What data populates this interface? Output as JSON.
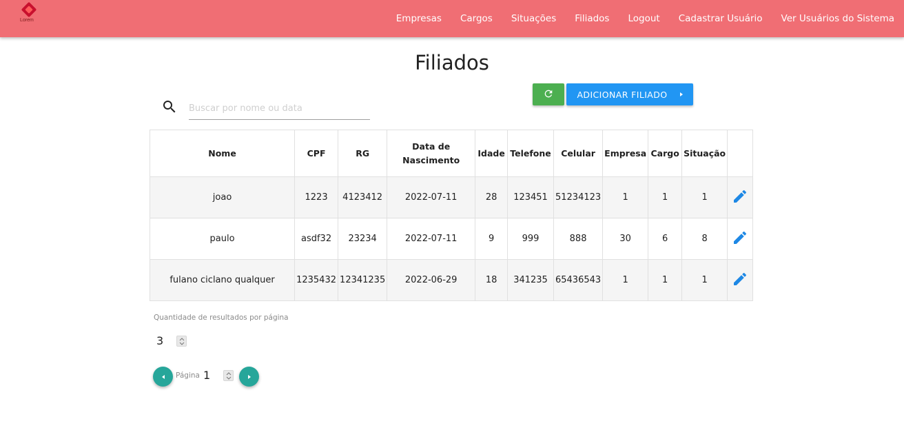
{
  "brand": {
    "logo_text": "Lorem"
  },
  "nav": {
    "items": [
      "Empresas",
      "Cargos",
      "Situações",
      "Filiados",
      "Logout",
      "Cadastrar Usuário",
      "Ver Usuários do Sistema"
    ]
  },
  "page": {
    "title": "Filiados"
  },
  "search": {
    "placeholder": "Buscar por nome ou data",
    "value": ""
  },
  "toolbar": {
    "add_label": "ADICIONAR FILIADO",
    "refresh_icon": "refresh-icon"
  },
  "table": {
    "headers": [
      "Nome",
      "CPF",
      "RG",
      "Data de Nascimento",
      "Idade",
      "Telefone",
      "Celular",
      "Empresa",
      "Cargo",
      "Situação",
      ""
    ],
    "rows": [
      [
        "joao",
        "1223",
        "4123412",
        "2022-07-11",
        "28",
        "123451",
        "51234123",
        "1",
        "1",
        "1"
      ],
      [
        "paulo",
        "asdf32",
        "23234",
        "2022-07-11",
        "9",
        "999",
        "888",
        "30",
        "6",
        "8"
      ],
      [
        "fulano ciclano qualquer",
        "1235432",
        "12341235",
        "2022-06-29",
        "18",
        "341235",
        "65436543",
        "1",
        "1",
        "1"
      ]
    ]
  },
  "pagination": {
    "per_page_label": "Quantidade de resultados por página",
    "per_page_value": "3",
    "page_label": "Página",
    "page_value": "1"
  },
  "colors": {
    "navbar": "#f06e74",
    "refresh_button": "#4caf50",
    "add_button": "#2196f3",
    "edit_icon": "#1e88e5",
    "pager_button": "#26a69a"
  }
}
